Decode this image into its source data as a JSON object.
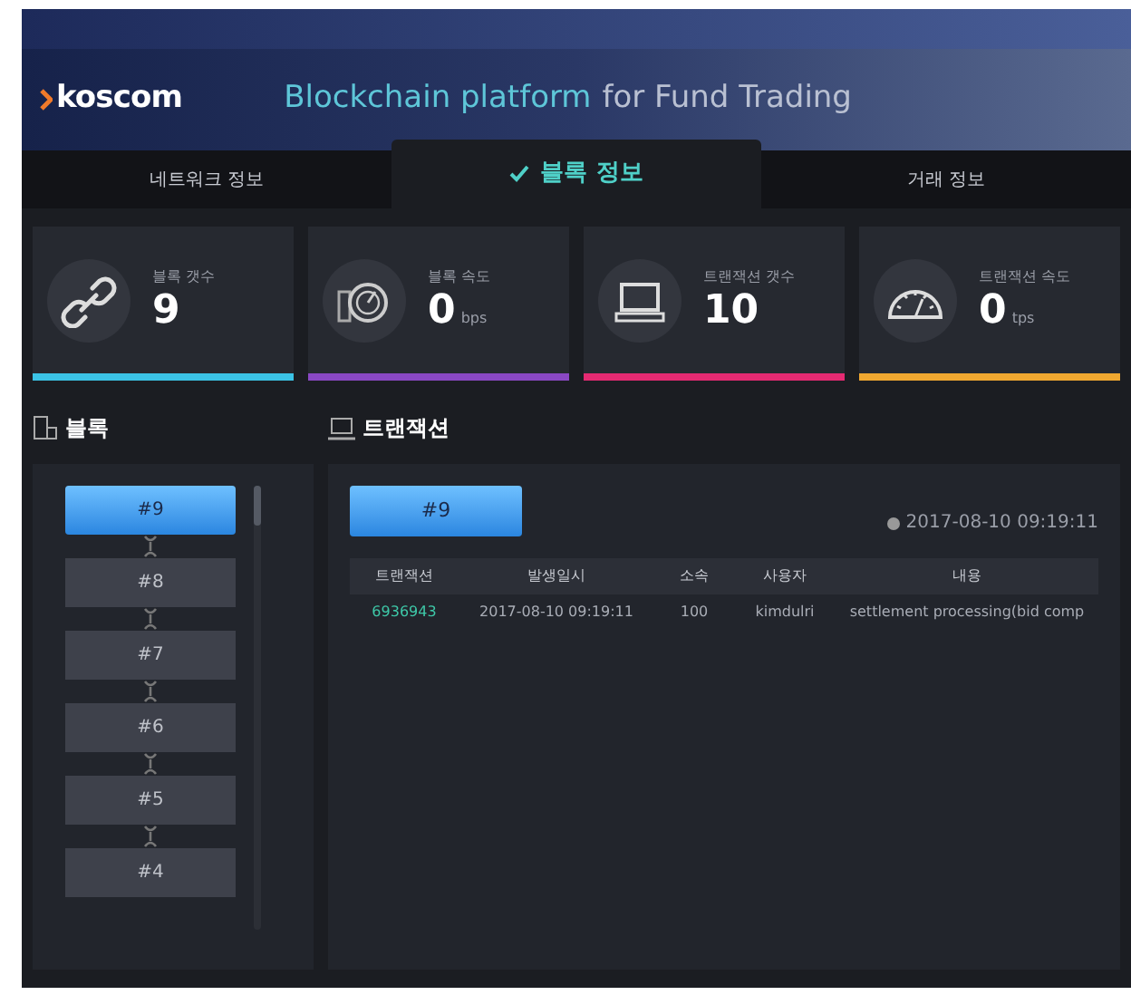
{
  "header": {
    "logo": "koscom",
    "title_highlight": "Blockchain platform",
    "title_rest": "for Fund Trading"
  },
  "tabs": [
    {
      "label": "네트워크 정보",
      "selected": false
    },
    {
      "label": "블록 정보",
      "selected": true
    },
    {
      "label": "거래 정보",
      "selected": false
    }
  ],
  "stats": [
    {
      "kind": "link",
      "label": "블록 갯수",
      "value": "9",
      "color": "#3bc3e6"
    },
    {
      "kind": "speed",
      "label": "블록 속도",
      "value": "0",
      "unit": "bps",
      "color": "#8a48c4"
    },
    {
      "kind": "laptop",
      "label": "트랜잭션 갯수",
      "value": "10",
      "color": "#e52a72"
    },
    {
      "kind": "gauge",
      "label": "트랜잭션 속도",
      "value": "0",
      "unit": "tps",
      "color": "#f0a830"
    }
  ],
  "blocks": {
    "heading": "블록",
    "items": [
      {
        "label": "#9",
        "selected": true
      },
      {
        "label": "#8",
        "selected": false
      },
      {
        "label": "#7",
        "selected": false
      },
      {
        "label": "#6",
        "selected": false
      },
      {
        "label": "#5",
        "selected": false
      },
      {
        "label": "#4",
        "selected": false
      }
    ]
  },
  "transactions": {
    "heading": "트랜잭션",
    "block": "#9",
    "timestamp": "2017-08-10 09:19:11",
    "table": {
      "columns": [
        "트랜잭션",
        "발생일시",
        "소속",
        "사용자",
        "내용"
      ],
      "rows": [
        [
          "6936943",
          "2017-08-10 09:19:11",
          "100",
          "kimdulri",
          "settlement processing(bid comp"
        ]
      ]
    }
  }
}
